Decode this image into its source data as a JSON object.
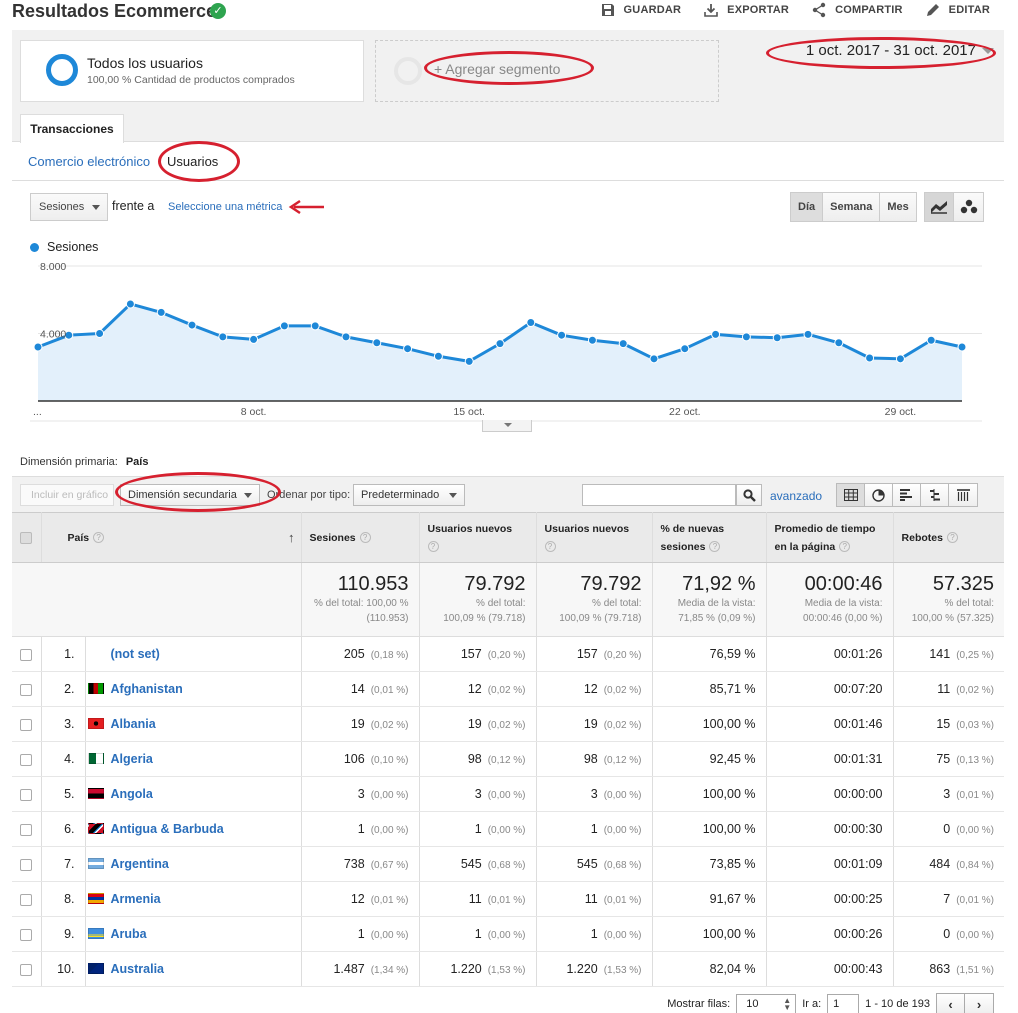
{
  "header": {
    "title": "Resultados Ecommerce",
    "actions": [
      {
        "icon": "save-icon",
        "label": "GUARDAR"
      },
      {
        "icon": "export-icon",
        "label": "EXPORTAR"
      },
      {
        "icon": "share-icon",
        "label": "COMPARTIR"
      },
      {
        "icon": "edit-icon",
        "label": "EDITAR"
      }
    ]
  },
  "segments": {
    "active": {
      "name": "Todos los usuarios",
      "sub": "100,00 % Cantidad de productos comprados"
    },
    "add_label": "+ Agregar segmento"
  },
  "date_range": "1 oct. 2017 - 31 oct. 2017",
  "tabs": {
    "active": "Transacciones"
  },
  "subtabs": [
    "Comercio electrónico",
    "Usuarios"
  ],
  "chart_controls": {
    "metric": "Sesiones",
    "versus": "frente a",
    "pick_metric": "Seleccione una métrica",
    "periods": [
      "Día",
      "Semana",
      "Mes"
    ],
    "active_period": "Día"
  },
  "chart_data": {
    "type": "area",
    "series": [
      {
        "name": "Sesiones",
        "values": [
          3200,
          3900,
          4000,
          5750,
          5250,
          4500,
          3800,
          3650,
          4450,
          4450,
          3800,
          3450,
          3100,
          2650,
          2350,
          3400,
          4650,
          3900,
          3600,
          3400,
          2500,
          3100,
          3950,
          3800,
          3750,
          3950,
          3450,
          2550,
          2500,
          3600,
          3200
        ]
      }
    ],
    "x": [
      1,
      2,
      3,
      4,
      5,
      6,
      7,
      8,
      9,
      10,
      11,
      12,
      13,
      14,
      15,
      16,
      17,
      18,
      19,
      20,
      21,
      22,
      23,
      24,
      25,
      26,
      27,
      28,
      29,
      30,
      31
    ],
    "ylim": [
      0,
      8000
    ],
    "y_ticks": [
      "4.000",
      "8.000"
    ],
    "y_tick_values": [
      4000,
      8000
    ],
    "x_ticks": [
      "...",
      "8 oct.",
      "15 oct.",
      "22 oct.",
      "29 oct."
    ],
    "x_tick_positions": [
      1,
      8,
      15,
      22,
      29
    ],
    "color": "#1e88d8",
    "fill": "#e3f0fb",
    "grid": true,
    "legend": "top-left"
  },
  "primary_dimension": {
    "label": "Dimensión primaria:",
    "value": "País"
  },
  "toolbar": {
    "plot_rows": "Incluir en gráfico",
    "secondary_dimension": "Dimensión secundaria",
    "sort_label": "Ordenar por tipo:",
    "sort_value": "Predeterminado",
    "search_value": "",
    "advanced": "avanzado"
  },
  "table": {
    "headers": {
      "country": "País",
      "sessions": "Sesiones",
      "new_users_1": "Usuarios nuevos",
      "new_users_2": "Usuarios nuevos",
      "pct_new": "% de nuevas sesiones",
      "avg_time": "Promedio de tiempo en la página",
      "bounces": "Rebotes"
    },
    "help_mark": "?",
    "totals": {
      "sessions": {
        "big": "110.953",
        "l1": "% del total: 100,00 %",
        "l2": "(110.953)"
      },
      "new_users_1": {
        "big": "79.792",
        "l1": "% del total:",
        "l2": "100,09 % (79.718)"
      },
      "new_users_2": {
        "big": "79.792",
        "l1": "% del total:",
        "l2": "100,09 % (79.718)"
      },
      "pct_new": {
        "big": "71,92 %",
        "l1": "Media de la vista:",
        "l2": "71,85 % (0,09 %)"
      },
      "avg_time": {
        "big": "00:00:46",
        "l1": "Media de la vista:",
        "l2": "00:00:46 (0,00 %)"
      },
      "bounces": {
        "big": "57.325",
        "l1": "% del total:",
        "l2": "100,00 % (57.325)"
      }
    },
    "rows": [
      {
        "idx": "1.",
        "country": "(not set)",
        "flag": "",
        "sessions": "205",
        "sessions_pct": "(0,18 %)",
        "nu1": "157",
        "nu1_pct": "(0,20 %)",
        "nu2": "157",
        "nu2_pct": "(0,20 %)",
        "pct_new": "76,59 %",
        "avg_time": "00:01:26",
        "bounces": "141",
        "bounces_pct": "(0,25 %)"
      },
      {
        "idx": "2.",
        "country": "Afghanistan",
        "flag": "af",
        "sessions": "14",
        "sessions_pct": "(0,01 %)",
        "nu1": "12",
        "nu1_pct": "(0,02 %)",
        "nu2": "12",
        "nu2_pct": "(0,02 %)",
        "pct_new": "85,71 %",
        "avg_time": "00:07:20",
        "bounces": "11",
        "bounces_pct": "(0,02 %)"
      },
      {
        "idx": "3.",
        "country": "Albania",
        "flag": "al",
        "sessions": "19",
        "sessions_pct": "(0,02 %)",
        "nu1": "19",
        "nu1_pct": "(0,02 %)",
        "nu2": "19",
        "nu2_pct": "(0,02 %)",
        "pct_new": "100,00 %",
        "avg_time": "00:01:46",
        "bounces": "15",
        "bounces_pct": "(0,03 %)"
      },
      {
        "idx": "4.",
        "country": "Algeria",
        "flag": "dz",
        "sessions": "106",
        "sessions_pct": "(0,10 %)",
        "nu1": "98",
        "nu1_pct": "(0,12 %)",
        "nu2": "98",
        "nu2_pct": "(0,12 %)",
        "pct_new": "92,45 %",
        "avg_time": "00:01:31",
        "bounces": "75",
        "bounces_pct": "(0,13 %)"
      },
      {
        "idx": "5.",
        "country": "Angola",
        "flag": "ao",
        "sessions": "3",
        "sessions_pct": "(0,00 %)",
        "nu1": "3",
        "nu1_pct": "(0,00 %)",
        "nu2": "3",
        "nu2_pct": "(0,00 %)",
        "pct_new": "100,00 %",
        "avg_time": "00:00:00",
        "bounces": "3",
        "bounces_pct": "(0,01 %)"
      },
      {
        "idx": "6.",
        "country": "Antigua & Barbuda",
        "flag": "ag",
        "sessions": "1",
        "sessions_pct": "(0,00 %)",
        "nu1": "1",
        "nu1_pct": "(0,00 %)",
        "nu2": "1",
        "nu2_pct": "(0,00 %)",
        "pct_new": "100,00 %",
        "avg_time": "00:00:30",
        "bounces": "0",
        "bounces_pct": "(0,00 %)"
      },
      {
        "idx": "7.",
        "country": "Argentina",
        "flag": "ar",
        "sessions": "738",
        "sessions_pct": "(0,67 %)",
        "nu1": "545",
        "nu1_pct": "(0,68 %)",
        "nu2": "545",
        "nu2_pct": "(0,68 %)",
        "pct_new": "73,85 %",
        "avg_time": "00:01:09",
        "bounces": "484",
        "bounces_pct": "(0,84 %)"
      },
      {
        "idx": "8.",
        "country": "Armenia",
        "flag": "am",
        "sessions": "12",
        "sessions_pct": "(0,01 %)",
        "nu1": "11",
        "nu1_pct": "(0,01 %)",
        "nu2": "11",
        "nu2_pct": "(0,01 %)",
        "pct_new": "91,67 %",
        "avg_time": "00:00:25",
        "bounces": "7",
        "bounces_pct": "(0,01 %)"
      },
      {
        "idx": "9.",
        "country": "Aruba",
        "flag": "aw",
        "sessions": "1",
        "sessions_pct": "(0,00 %)",
        "nu1": "1",
        "nu1_pct": "(0,00 %)",
        "nu2": "1",
        "nu2_pct": "(0,00 %)",
        "pct_new": "100,00 %",
        "avg_time": "00:00:26",
        "bounces": "0",
        "bounces_pct": "(0,00 %)"
      },
      {
        "idx": "10.",
        "country": "Australia",
        "flag": "au",
        "sessions": "1.487",
        "sessions_pct": "(1,34 %)",
        "nu1": "1.220",
        "nu1_pct": "(1,53 %)",
        "nu2": "1.220",
        "nu2_pct": "(1,53 %)",
        "pct_new": "82,04 %",
        "avg_time": "00:00:43",
        "bounces": "863",
        "bounces_pct": "(1,51 %)"
      }
    ]
  },
  "pager": {
    "show_rows_label": "Mostrar filas:",
    "rows_value": "10",
    "goto_label": "Ir a:",
    "goto_value": "1",
    "range": "1 - 10 de 193"
  },
  "annotation_color": "#d6202f"
}
